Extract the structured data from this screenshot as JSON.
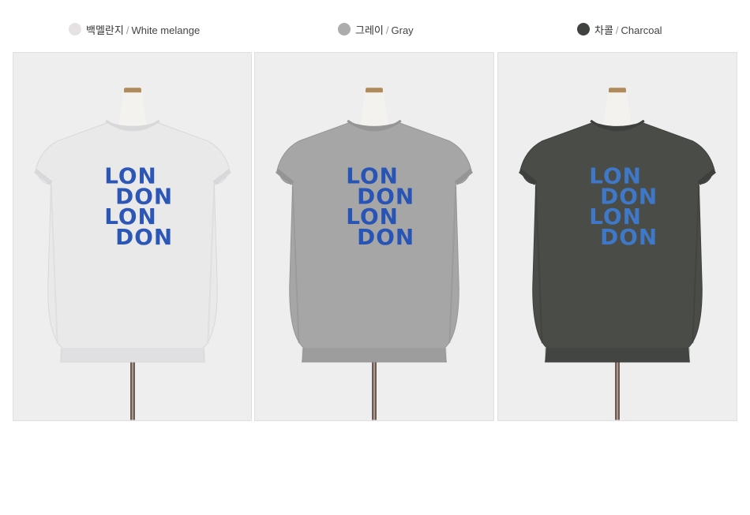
{
  "colors": [
    {
      "name_ko": "백멜란지",
      "separator": "/",
      "name_en": "White melange",
      "swatch": "#e6e2e2",
      "shirt_color": "#e9e9ea",
      "shirt_shade": "#d8d8da",
      "print_color": "#2d57b7",
      "print_lines": [
        "LON",
        "DON",
        "LON",
        "DON"
      ]
    },
    {
      "name_ko": "그레이",
      "separator": "/",
      "name_en": "Gray",
      "swatch": "#acacac",
      "shirt_color": "#a6a6a6",
      "shirt_shade": "#959595",
      "print_color": "#2854b6",
      "print_lines": [
        "LON",
        "DON",
        "LON",
        "DON"
      ]
    },
    {
      "name_ko": "차콜",
      "separator": "/",
      "name_en": "Charcoal",
      "swatch": "#3f423f",
      "shirt_color": "#494c47",
      "shirt_shade": "#3d403c",
      "print_color": "#3f78c9",
      "print_lines": [
        "LON",
        "DON",
        "LON",
        "DON"
      ]
    }
  ]
}
